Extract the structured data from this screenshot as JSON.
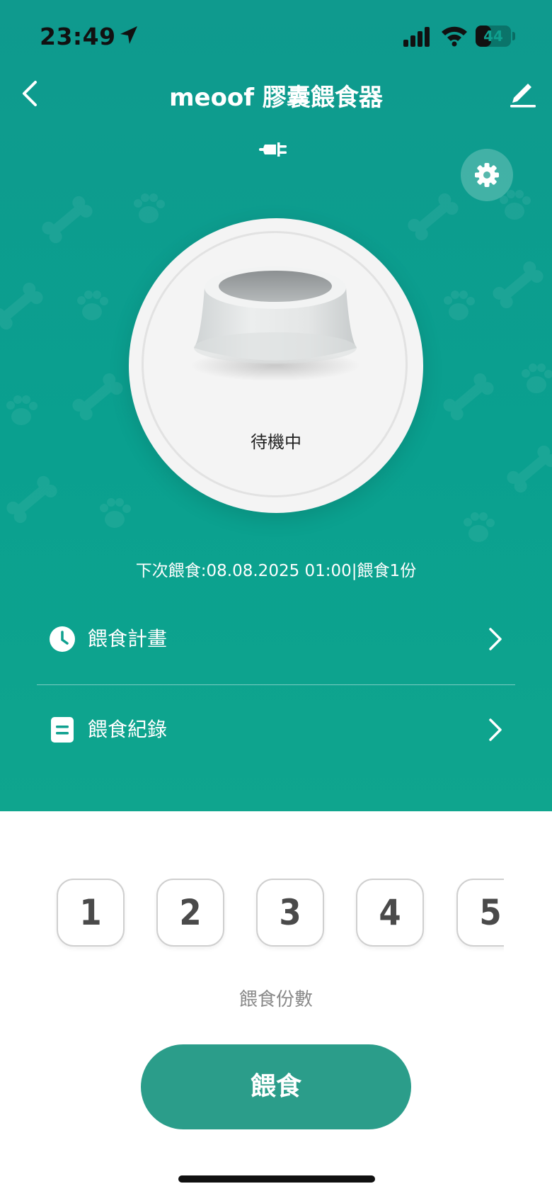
{
  "status_bar": {
    "time": "23:49",
    "battery_text": "44",
    "battery_level": 0.44
  },
  "header": {
    "title": "meoof 膠囊餵食器"
  },
  "device": {
    "status_text": "待機中",
    "next_feed_text": "下次餵食:08.08.2025 01:00|餵食1份"
  },
  "menu": [
    {
      "label": "餵食計畫",
      "icon": "clock-icon"
    },
    {
      "label": "餵食紀錄",
      "icon": "document-icon"
    }
  ],
  "portions": {
    "options": [
      "1",
      "2",
      "3",
      "4",
      "5"
    ],
    "label": "餵食份數"
  },
  "feed_button": {
    "label": "餵食"
  },
  "colors": {
    "header_bg": "#0fa08f",
    "feed_button_bg": "#2b9d8a",
    "portion_border": "#cfcfcf"
  }
}
